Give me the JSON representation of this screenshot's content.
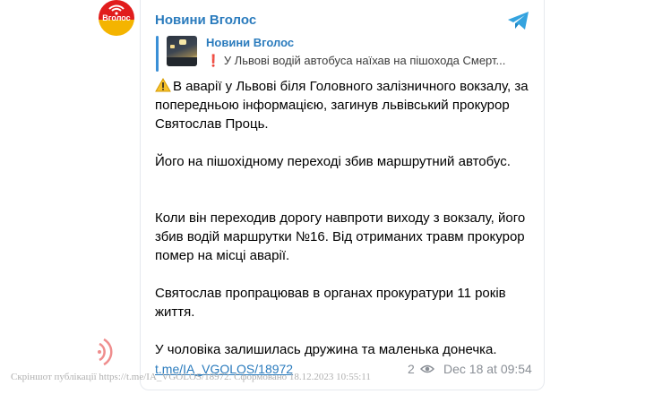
{
  "post": {
    "channel_name": "Новини Вголос",
    "avatar_logo_text": "Вголос",
    "quote": {
      "title": "Новини Вголос",
      "snippet": "У Львові водій автобуса наїхав на пішохода Смерт..."
    },
    "paragraphs": [
      "В аварії у Львові біля Головного залізничного вокзалу, за попередньою інформацією, загинув львівський прокурор Святослав Проць.",
      "Його на пішохідному переході збив маршрутний автобус.",
      "Коли він переходив дорогу навпроти виходу з вокзалу, його збив водій маршрутки №16. Від отриманих травм прокурор помер на місці аварії.",
      "Святослав пропрацював в органах прокуратури 11 років життя.",
      "У чоловіка залишилась дружина та маленька донечка."
    ],
    "link": "t.me/IA_VGOLOS/18972",
    "views": "2",
    "date": "Dec 18 at 09:54"
  },
  "watermark": "Скріншот публікації https://t.me/IA_VGOLOS/18972. Сформовано 18.12.2023 10:55:11",
  "icons": {
    "telegram": "telegram-icon",
    "warning": "warning-icon",
    "eye": "eye-icon",
    "exclamation": "red-exclamation-icon"
  },
  "colors": {
    "link_blue": "#2a7bbd",
    "quote_bar": "#3a8fd6",
    "meta_gray": "#8a8f96",
    "brand_red": "#e11d1d",
    "brand_yellow": "#f4b400"
  }
}
